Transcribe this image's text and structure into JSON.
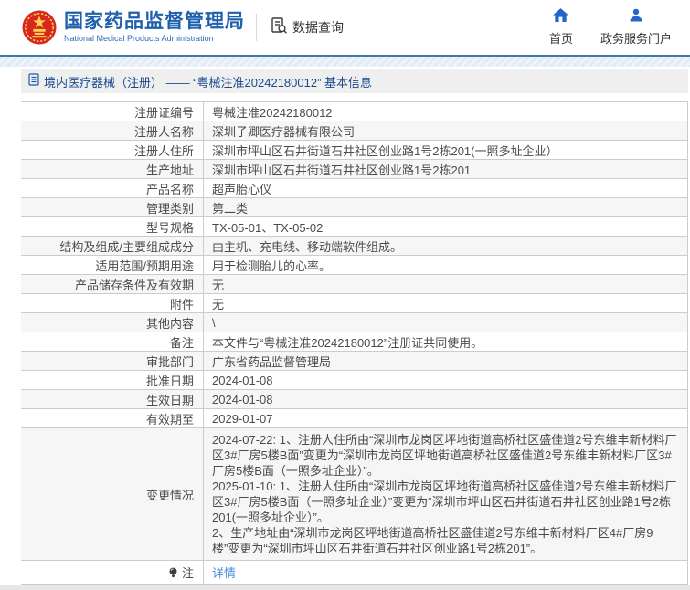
{
  "header": {
    "logo": {
      "title": "国家药品监督管理局",
      "subtitle": "National Medical Products Administration"
    },
    "data_query_label": "数据查询",
    "nav_items": [
      {
        "icon": "home-icon",
        "label": "首页"
      },
      {
        "icon": "user-icon",
        "label": "政务服务门户"
      }
    ]
  },
  "breadcrumb": {
    "text": "境内医疗器械（注册） —— “粤械注准20242180012” 基本信息"
  },
  "table": {
    "rows": [
      {
        "label": "注册证编号",
        "value": "粤械注准20242180012"
      },
      {
        "label": "注册人名称",
        "value": "深圳子卿医疗器械有限公司"
      },
      {
        "label": "注册人住所",
        "value": "深圳市坪山区石井街道石井社区创业路1号2栋201(一照多址企业）"
      },
      {
        "label": "生产地址",
        "value": "深圳市坪山区石井街道石井社区创业路1号2栋201"
      },
      {
        "label": "产品名称",
        "value": "超声胎心仪"
      },
      {
        "label": "管理类别",
        "value": "第二类"
      },
      {
        "label": "型号规格",
        "value": "TX-05-01、TX-05-02"
      },
      {
        "label": "结构及组成/主要组成成分",
        "value": "由主机、充电线、移动端软件组成。"
      },
      {
        "label": "适用范围/预期用途",
        "value": "用于检测胎儿的心率。"
      },
      {
        "label": "产品储存条件及有效期",
        "value": "无"
      },
      {
        "label": "附件",
        "value": "无"
      },
      {
        "label": "其他内容",
        "value": "\\"
      },
      {
        "label": "备注",
        "value": "本文件与“粤械注准20242180012”注册证共同使用。"
      },
      {
        "label": "审批部门",
        "value": "广东省药品监督管理局"
      },
      {
        "label": "批准日期",
        "value": "2024-01-08"
      },
      {
        "label": "生效日期",
        "value": "2024-01-08"
      },
      {
        "label": "有效期至",
        "value": "2029-01-07"
      },
      {
        "label": "变更情况",
        "paragraphs": [
          "2024-07-22: 1、注册人住所由“深圳市龙岗区坪地街道高桥社区盛佳道2号东维丰新材料厂区3#厂房5楼B面”变更为“深圳市龙岗区坪地街道高桥社区盛佳道2号东维丰新材料厂区3#厂房5楼B面（一照多址企业）”。",
          "2025-01-10: 1、注册人住所由“深圳市龙岗区坪地街道高桥社区盛佳道2号东维丰新材料厂区3#厂房5楼B面（一照多址企业）”变更为“深圳市坪山区石井街道石井社区创业路1号2栋201(一照多址企业）”。",
          "2、生产地址由“深圳市龙岗区坪地街道高桥社区盛佳道2号东维丰新材料厂区4#厂房9楼”变更为“深圳市坪山区石井街道石井社区创业路1号2栋201”。"
        ]
      },
      {
        "label": "注",
        "icon": "note-icon",
        "link": "详情"
      }
    ]
  },
  "colors": {
    "brand_blue": "#1e5fae",
    "nav_icon_blue": "#2465c8",
    "link_blue": "#4a90d9",
    "breadcrumb_text": "#164a8f",
    "header_rule_blue": "#4179b5",
    "row_alt_bg": "#f6f6f6",
    "table_border": "#cccccc",
    "emblem_red": "#d7281f",
    "emblem_gold": "#ffd34d"
  }
}
